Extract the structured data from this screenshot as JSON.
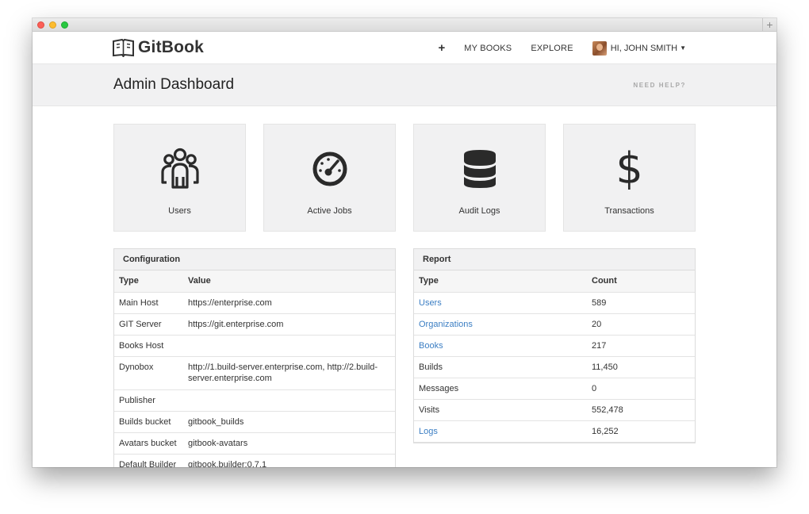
{
  "navbar": {
    "brand": "GitBook",
    "plus": "+",
    "my_books": "MY BOOKS",
    "explore": "EXPLORE",
    "user": "HI, JOHN SMITH"
  },
  "header": {
    "title": "Admin Dashboard",
    "help": "NEED HELP?"
  },
  "tiles": [
    {
      "label": "Users",
      "icon": "users-icon"
    },
    {
      "label": "Active Jobs",
      "icon": "dashboard-gauge-icon"
    },
    {
      "label": "Audit Logs",
      "icon": "database-icon"
    },
    {
      "label": "Transactions",
      "icon": "dollar-icon"
    }
  ],
  "configuration": {
    "title": "Configuration",
    "columns": [
      "Type",
      "Value"
    ],
    "rows": [
      {
        "type": "Main Host",
        "value": "https://enterprise.com"
      },
      {
        "type": "GIT Server",
        "value": "https://git.enterprise.com"
      },
      {
        "type": "Books Host",
        "value": ""
      },
      {
        "type": "Dynobox",
        "value": "http://1.build-server.enterprise.com, http://2.build-server.enterprise.com"
      },
      {
        "type": "Publisher",
        "value": ""
      },
      {
        "type": "Builds bucket",
        "value": "gitbook_builds"
      },
      {
        "type": "Avatars bucket",
        "value": "gitbook-avatars"
      },
      {
        "type": "Default Builder",
        "value": "gitbook.builder:0.7.1"
      }
    ]
  },
  "report": {
    "title": "Report",
    "columns": [
      "Type",
      "Count"
    ],
    "rows": [
      {
        "type": "Users",
        "count": "589",
        "link": true
      },
      {
        "type": "Organizations",
        "count": "20",
        "link": true
      },
      {
        "type": "Books",
        "count": "217",
        "link": true
      },
      {
        "type": "Builds",
        "count": "11,450",
        "link": false
      },
      {
        "type": "Messages",
        "count": "0",
        "link": false
      },
      {
        "type": "Visits",
        "count": "552,478",
        "link": false
      },
      {
        "type": "Logs",
        "count": "16,252",
        "link": true
      }
    ]
  },
  "colors": {
    "link": "#3b7ec3",
    "tile_bg": "#f1f1f2",
    "header_bg": "#f1f1f2",
    "icon": "#2a2a2a"
  }
}
